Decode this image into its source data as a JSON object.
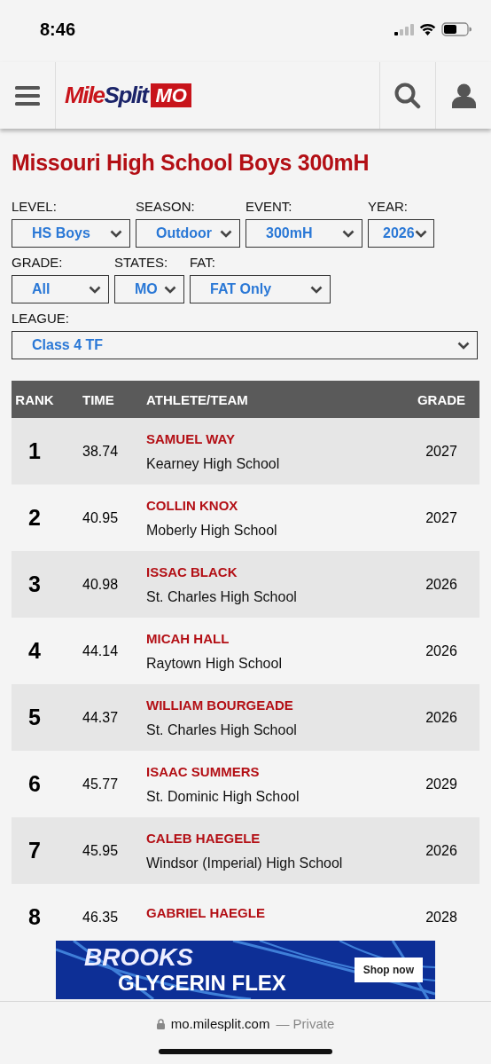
{
  "status_bar": {
    "time": "8:46"
  },
  "header": {
    "logo": {
      "part1": "Mile",
      "part2": "Split",
      "badge": "MO"
    }
  },
  "title": "Missouri High School Boys 300mH",
  "filter_rows": [
    [
      {
        "label": "LEVEL:",
        "value": "HS Boys"
      },
      {
        "label": "SEASON:",
        "value": "Outdoor"
      },
      {
        "label": "EVENT:",
        "value": "300mH"
      },
      {
        "label": "YEAR:",
        "value": "2026"
      }
    ],
    [
      {
        "label": "GRADE:",
        "value": "All"
      },
      {
        "label": "STATES:",
        "value": "MO"
      },
      {
        "label": "FAT:",
        "value": "FAT Only"
      }
    ],
    [
      {
        "label": "LEAGUE:",
        "value": "Class 4 TF"
      }
    ]
  ],
  "table": {
    "columns": [
      "RANK",
      "TIME",
      "ATHLETE/TEAM",
      "GRADE"
    ],
    "rows": [
      {
        "rank": "1",
        "time": "38.74",
        "athlete": "SAMUEL WAY",
        "team": "Kearney High School",
        "grade": "2027"
      },
      {
        "rank": "2",
        "time": "40.95",
        "athlete": "COLLIN KNOX",
        "team": "Moberly High School",
        "grade": "2027"
      },
      {
        "rank": "3",
        "time": "40.98",
        "athlete": "ISSAC BLACK",
        "team": "St. Charles High School",
        "grade": "2026"
      },
      {
        "rank": "4",
        "time": "44.14",
        "athlete": "MICAH HALL",
        "team": "Raytown High School",
        "grade": "2026"
      },
      {
        "rank": "5",
        "time": "44.37",
        "athlete": "WILLIAM BOURGEADE",
        "team": "St. Charles High School",
        "grade": "2026"
      },
      {
        "rank": "6",
        "time": "45.77",
        "athlete": "ISAAC SUMMERS",
        "team": "St. Dominic High School",
        "grade": "2029"
      },
      {
        "rank": "7",
        "time": "45.95",
        "athlete": "CALEB HAEGELE",
        "team": "Windsor (Imperial) High School",
        "grade": "2026"
      },
      {
        "rank": "8",
        "time": "46.35",
        "athlete": "GABRIEL HAEGLE",
        "grade": "2028"
      }
    ]
  },
  "ad": {
    "brand": "BROOKS",
    "product": "GLYCERIN FLEX",
    "button": "Shop now"
  },
  "browser_bar": {
    "url": "mo.milesplit.com",
    "mode": "— Private"
  }
}
